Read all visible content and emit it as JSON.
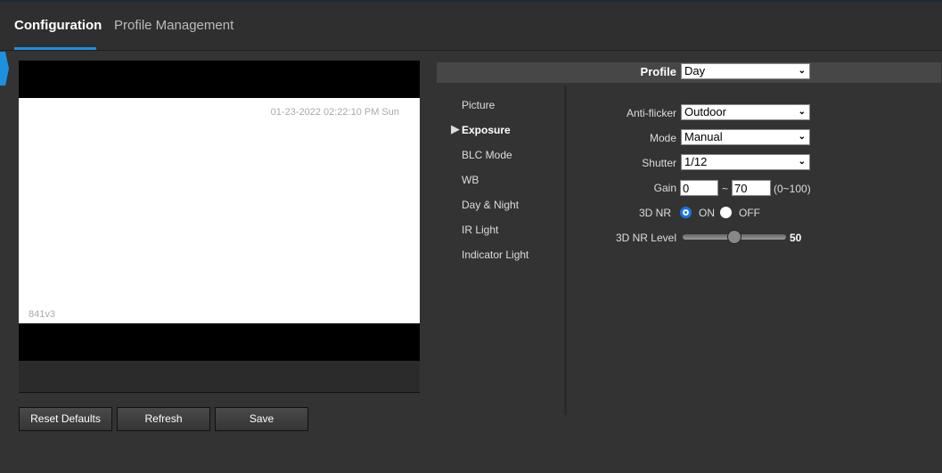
{
  "tabs": [
    {
      "label": "Configuration",
      "active": true
    },
    {
      "label": "Profile Management",
      "active": false
    }
  ],
  "video": {
    "timestamp": "01-23-2022 02:22:10 PM Sun",
    "camera_name": "841v3"
  },
  "buttons": {
    "reset": "Reset Defaults",
    "refresh": "Refresh",
    "save": "Save"
  },
  "profile": {
    "label": "Profile",
    "value": "Day"
  },
  "menu": [
    {
      "label": "Picture"
    },
    {
      "label": "Exposure",
      "active": true
    },
    {
      "label": "BLC Mode"
    },
    {
      "label": "WB"
    },
    {
      "label": "Day & Night"
    },
    {
      "label": "IR Light"
    },
    {
      "label": "Indicator Light"
    }
  ],
  "form": {
    "anti_flicker": {
      "label": "Anti-flicker",
      "value": "Outdoor"
    },
    "mode": {
      "label": "Mode",
      "value": "Manual"
    },
    "shutter": {
      "label": "Shutter",
      "value": "1/12"
    },
    "gain": {
      "label": "Gain",
      "min": "0",
      "sep": "~",
      "max": "70",
      "range": "(0~100)"
    },
    "nr3d": {
      "label": "3D NR",
      "on": "ON",
      "off": "OFF",
      "selected": "ON"
    },
    "nr3d_level": {
      "label": "3D NR Level",
      "value": 50,
      "display": "50",
      "min": 0,
      "max": 100
    }
  },
  "colors": {
    "accent": "#1e90e0",
    "background": "#333333"
  }
}
